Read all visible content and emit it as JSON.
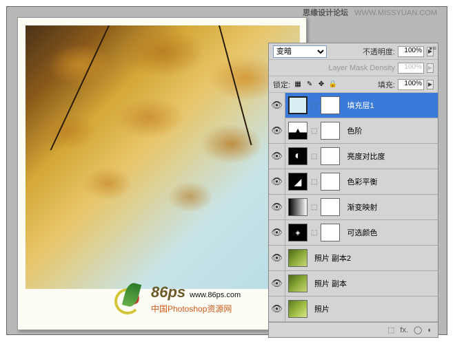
{
  "watermark": {
    "forum": "思缘设计论坛",
    "url": "WWW.MISSYUAN.COM"
  },
  "logo": {
    "big": "86ps",
    "url": "www.86ps.com",
    "cn": "中国Photoshop资源网"
  },
  "panel": {
    "blend": {
      "value": "变暗"
    },
    "opacity": {
      "label": "不透明度:",
      "value": "100%"
    },
    "density": {
      "label": "Layer Mask Density",
      "value": "100%"
    },
    "lock": {
      "label": "锁定:"
    },
    "fill": {
      "label": "填充:",
      "value": "100%"
    }
  },
  "layers": [
    {
      "name": "填充层1",
      "type": "fill",
      "sel": true
    },
    {
      "name": "色阶",
      "type": "levels"
    },
    {
      "name": "亮度对比度",
      "type": "bc"
    },
    {
      "name": "色彩平衡",
      "type": "bal"
    },
    {
      "name": "渐变映射",
      "type": "grad"
    },
    {
      "name": "可选颜色",
      "type": "selcol"
    },
    {
      "name": "照片 副本2",
      "type": "img1"
    },
    {
      "name": "照片 副本",
      "type": "img1"
    },
    {
      "name": "照片",
      "type": "img2"
    }
  ],
  "bottombar": {
    "fx": "fx."
  }
}
